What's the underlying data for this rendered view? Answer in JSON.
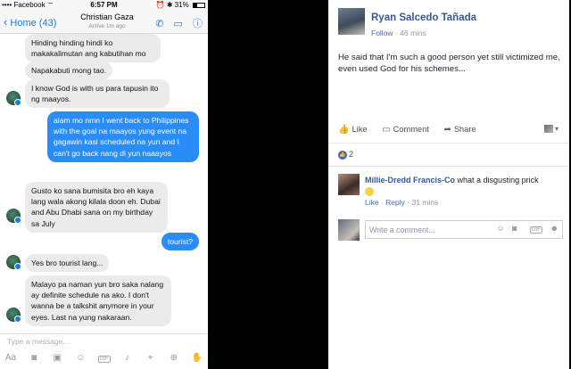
{
  "messenger": {
    "status": {
      "carrier": "Facebook",
      "signal": "••••",
      "wifi": "⌔",
      "time": "6:57 PM",
      "battery": "31%"
    },
    "header": {
      "back_label": "Home (43)",
      "contact_name": "Christian Gaza",
      "active_text": "Active 1m ago"
    },
    "messages": [
      {
        "dir": "in",
        "text": "Hinding hinding hindi ko makakalimutan ang kabutihan mo"
      },
      {
        "dir": "in",
        "text": "Napakabuti mong tao."
      },
      {
        "dir": "in",
        "text": "I know God is with us para tapusin ito ng maayos."
      },
      {
        "dir": "out",
        "text": "alam mo nmn I went back to Philippines with the goal na maayos yung event na gagawin kasi scheduled na yun and I can't go back nang di yun naaayos"
      },
      {
        "dir": "in",
        "text": "Gusto ko sana bumisita bro eh kaya lang wala akong kilala doon eh. Dubai and Abu Dhabi sana on my birthday sa July"
      },
      {
        "dir": "out",
        "text": "tourist?"
      },
      {
        "dir": "in",
        "text": "Yes bro tourist lang..."
      },
      {
        "dir": "in",
        "text": "Malayo pa naman yun bro saka nalang ay definite schedule na ako. I don't wanna be a talkshit anymore in your eyes. Last na yung nakaraan."
      }
    ],
    "composer": {
      "placeholder": "Type a message...",
      "gif_label": "GIF"
    }
  },
  "facebook": {
    "author": "Ryan Salcedo Tañada",
    "follow_label": "Follow",
    "timestamp": "46 mins",
    "post_text": "He said that I'm such a good person yet still victimized me, even used God for his schemes...",
    "actions": {
      "like": "Like",
      "comment": "Comment",
      "share": "Share"
    },
    "like_count": "2",
    "comment": {
      "author": "Millie-Dredd Francis-Co",
      "text": "what a disgusting prick",
      "like_label": "Like",
      "reply_label": "Reply",
      "time": "31 mins"
    },
    "write_comment_placeholder": "Write a comment...",
    "gif_label": "GIF"
  }
}
